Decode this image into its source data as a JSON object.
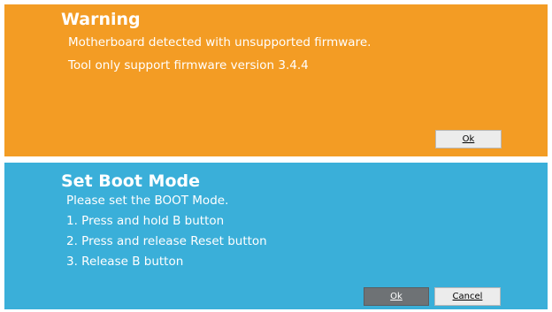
{
  "warning_dialog": {
    "title": "Warning",
    "lines": [
      "Motherboard detected with unsupported firmware.",
      "Tool only support firmware version 3.4.4"
    ],
    "ok_label": "Ok",
    "color": "#f39c24"
  },
  "boot_dialog": {
    "title": "Set Boot Mode",
    "lines": [
      "Please set the BOOT Mode.",
      "1. Press and hold B button",
      "2. Press and release Reset button",
      "3. Release B button"
    ],
    "ok_label": "Ok",
    "cancel_label": "Cancel",
    "color": "#3aafd9"
  }
}
